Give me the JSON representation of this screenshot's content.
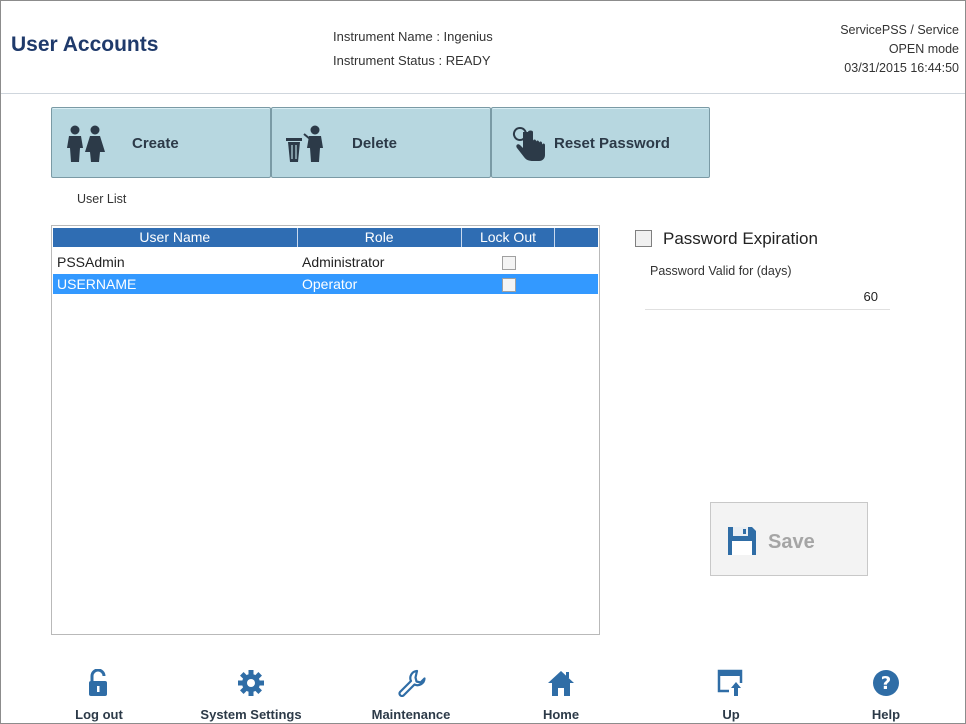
{
  "header": {
    "title": "User Accounts",
    "instrument_name": "Instrument Name : Ingenius",
    "instrument_status": "Instrument Status : READY",
    "user": "ServicePSS / Service",
    "mode": "OPEN mode",
    "datetime": "03/31/2015 16:44:50"
  },
  "toolbar": {
    "create_label": "Create",
    "delete_label": "Delete",
    "reset_label": "Reset Password"
  },
  "user_list": {
    "label": "User List",
    "columns": [
      "User Name",
      "Role",
      "Lock Out"
    ],
    "rows": [
      {
        "name": "PSSAdmin",
        "role": "Administrator",
        "locked": false,
        "selected": false
      },
      {
        "name": "USERNAME",
        "role": "Operator",
        "locked": false,
        "selected": true
      }
    ]
  },
  "password": {
    "expiration_label": "Password Expiration",
    "expiration_checked": false,
    "valid_label": "Password Valid for (days)",
    "valid_value": "60"
  },
  "save_label": "Save",
  "nav": {
    "logout": "Log out",
    "system_settings": "System Settings",
    "maintenance": "Maintenance",
    "home": "Home",
    "up": "Up",
    "help": "Help"
  },
  "colors": {
    "title": "#1f3a6b",
    "button_bg": "#b7d7e0",
    "table_header": "#2f6db3",
    "selection": "#3399ff"
  }
}
